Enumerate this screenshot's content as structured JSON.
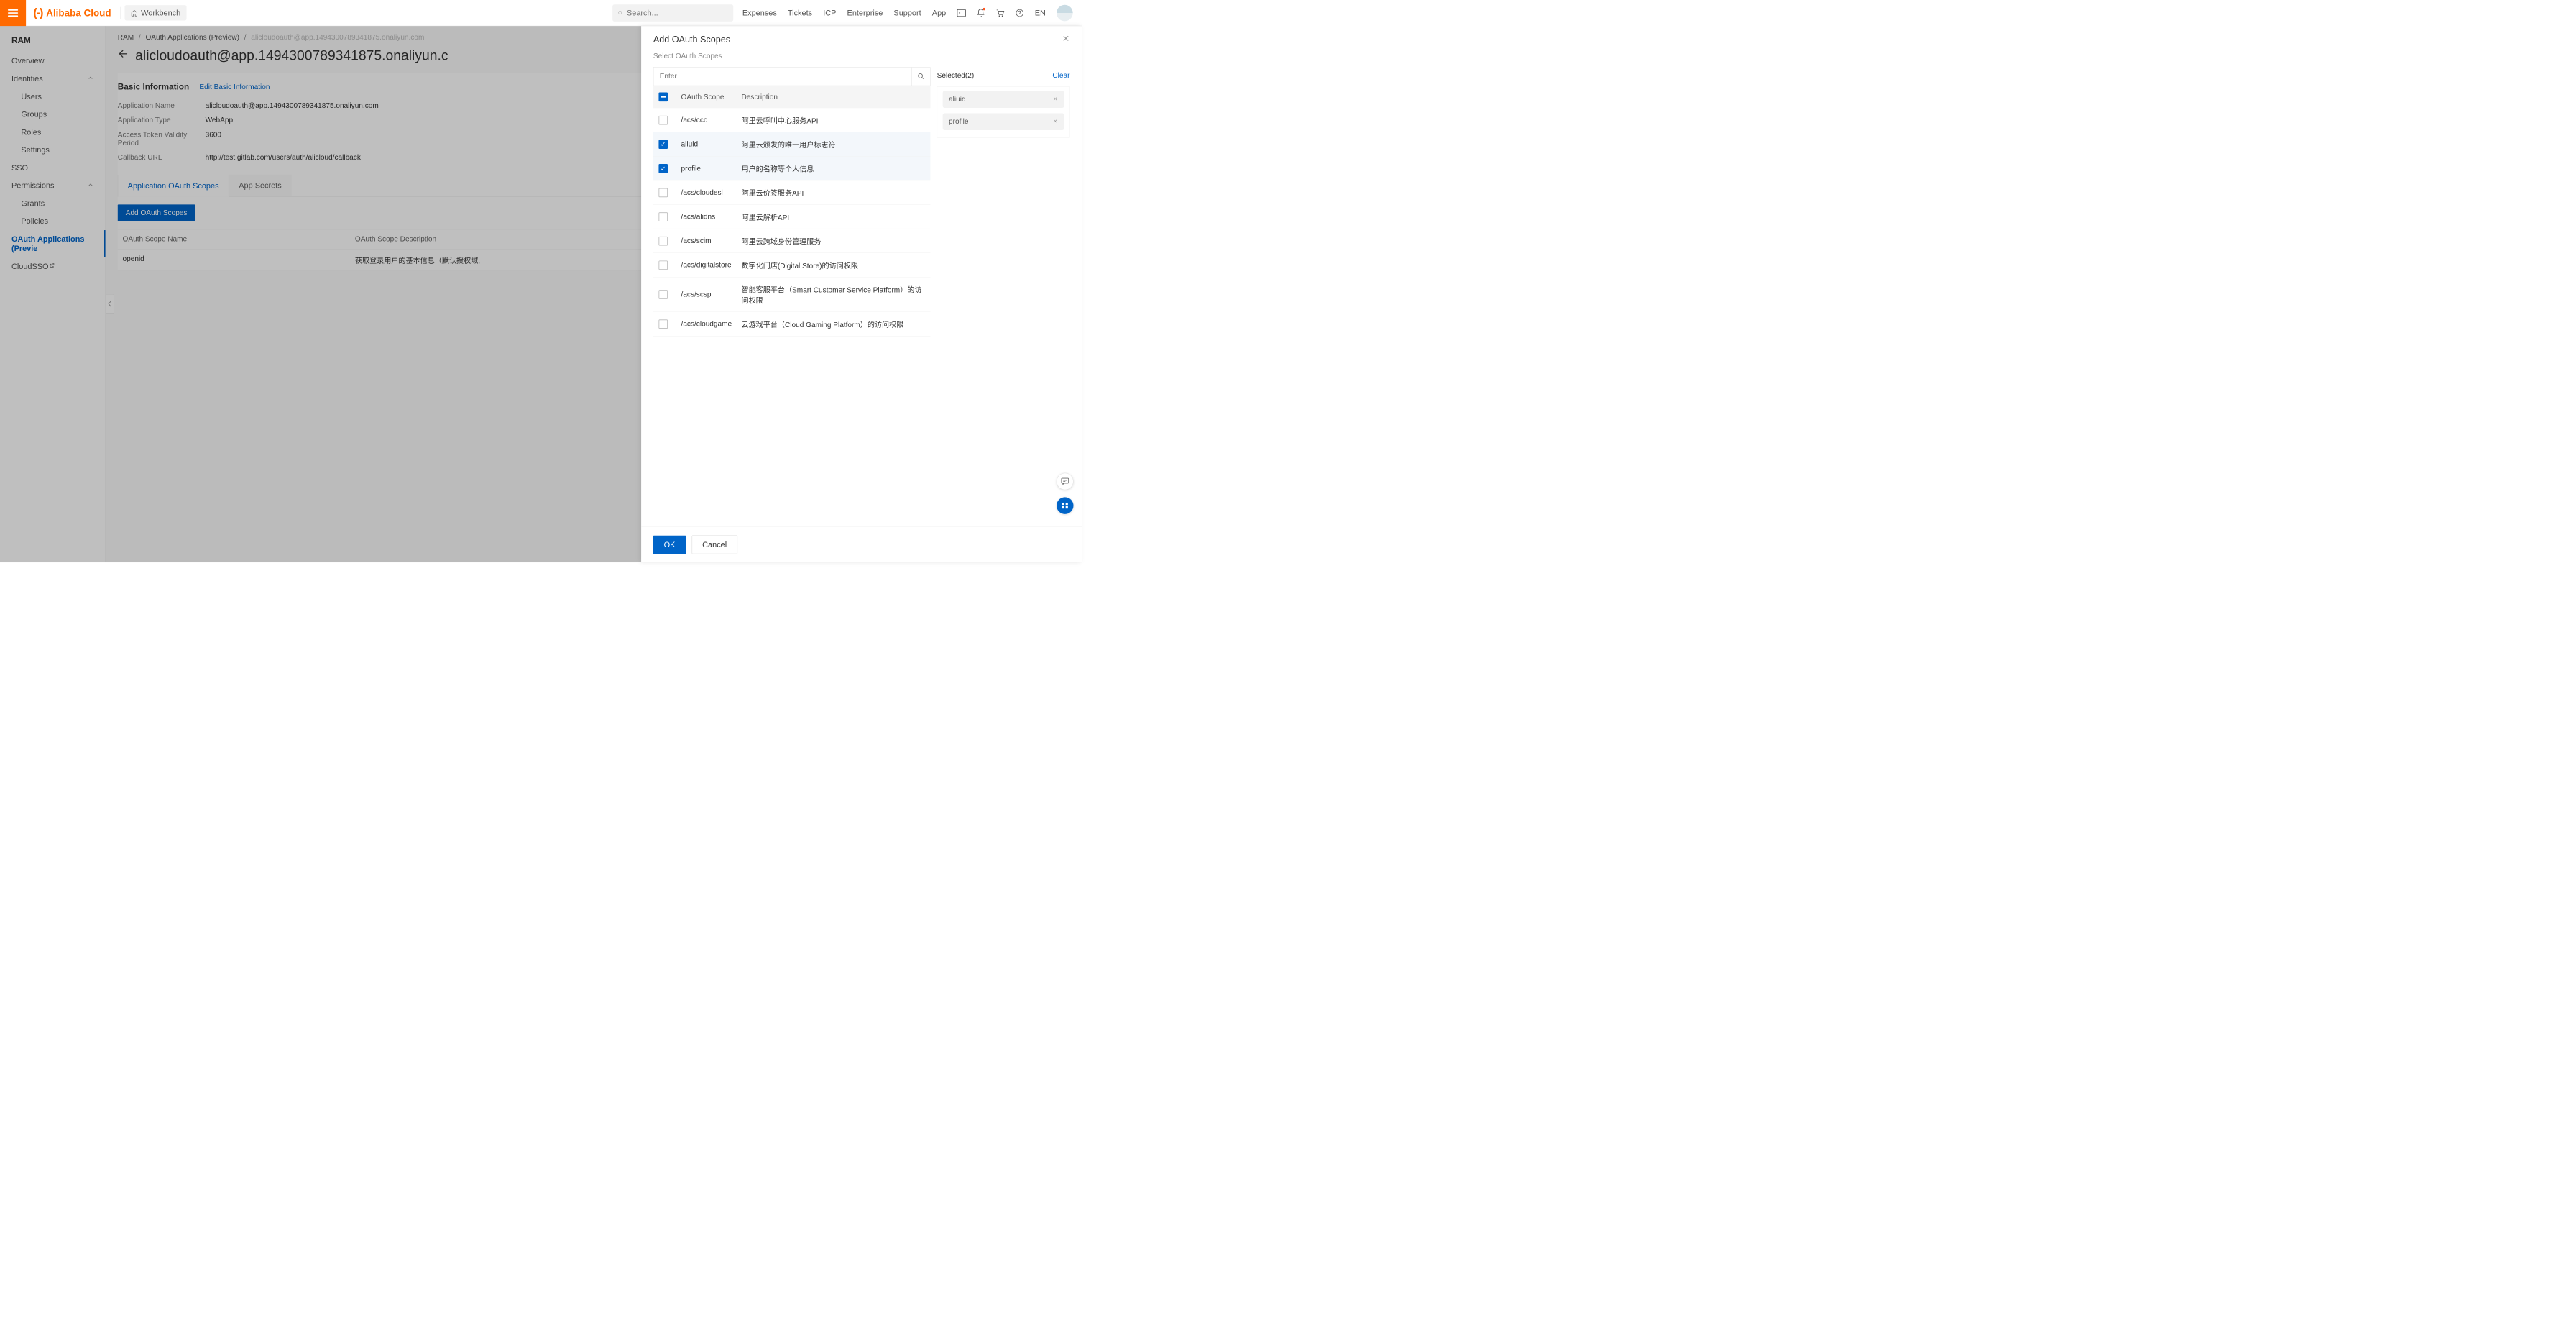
{
  "top": {
    "brand": "Alibaba Cloud",
    "workbench": "Workbench",
    "search_placeholder": "Search...",
    "nav": {
      "expenses": "Expenses",
      "tickets": "Tickets",
      "icp": "ICP",
      "enterprise": "Enterprise",
      "support": "Support",
      "app": "App",
      "lang": "EN"
    }
  },
  "sidebar": {
    "title": "RAM",
    "items": [
      {
        "label": "Overview"
      },
      {
        "label": "Identities",
        "expandable": true
      },
      {
        "label": "Users",
        "sub": true
      },
      {
        "label": "Groups",
        "sub": true
      },
      {
        "label": "Roles",
        "sub": true
      },
      {
        "label": "Settings",
        "sub": true
      },
      {
        "label": "SSO"
      },
      {
        "label": "Permissions",
        "expandable": true
      },
      {
        "label": "Grants",
        "sub": true
      },
      {
        "label": "Policies",
        "sub": true
      },
      {
        "label": "OAuth Applications (Previe",
        "active": true
      },
      {
        "label": "CloudSSO",
        "external": true
      }
    ]
  },
  "breadcrumb": {
    "a": "RAM",
    "b": "OAuth Applications (Preview)",
    "c": "alicloudoauth@app.1494300789341875.onaliyun.com",
    "sep": "/"
  },
  "page": {
    "title": "alicloudoauth@app.1494300789341875.onaliyun.c",
    "section_heading": "Basic Information",
    "edit_link": "Edit Basic Information",
    "info": [
      {
        "label": "Application Name",
        "value": "alicloudoauth@app.1494300789341875.onaliyun.com"
      },
      {
        "label": "Application Type",
        "value": "WebApp"
      },
      {
        "label": "Access Token Validity Period",
        "value": "3600"
      },
      {
        "label": "Callback URL",
        "value": "http://test.gitlab.com/users/auth/alicloud/callback"
      }
    ],
    "tabs": {
      "a": "Application OAuth Scopes",
      "b": "App Secrets"
    },
    "add_btn": "Add OAuth Scopes",
    "table": {
      "h1": "OAuth Scope Name",
      "h2": "OAuth Scope Description",
      "rows": [
        {
          "name": "openid",
          "desc": "获取登录用户的基本信息（默认授权域,"
        }
      ]
    }
  },
  "drawer": {
    "title": "Add OAuth Scopes",
    "hint": "Select OAuth Scopes",
    "search_placeholder": "Enter",
    "head_scope": "OAuth Scope",
    "head_desc": "Description",
    "rows": [
      {
        "scope": "/acs/ccc",
        "desc": "阿里云呼叫中心服务API",
        "checked": false
      },
      {
        "scope": "aliuid",
        "desc": "阿里云颁发的唯一用户标志符",
        "checked": true
      },
      {
        "scope": "profile",
        "desc": "用户的名称等个人信息",
        "checked": true
      },
      {
        "scope": "/acs/cloudesl",
        "desc": "阿里云价签服务API",
        "checked": false
      },
      {
        "scope": "/acs/alidns",
        "desc": "阿里云解析API",
        "checked": false
      },
      {
        "scope": "/acs/scim",
        "desc": "阿里云跨域身份管理服务",
        "checked": false
      },
      {
        "scope": "/acs/digitalstore",
        "desc": "数字化门店(Digital Store)的访问权限",
        "checked": false
      },
      {
        "scope": "/acs/scsp",
        "desc": "智能客服平台（Smart Customer Service Platform）的访问权限",
        "checked": false
      },
      {
        "scope": "/acs/cloudgame",
        "desc": "云游戏平台（Cloud Gaming Platform）的访问权限",
        "checked": false
      }
    ],
    "selected_label": "Selected(2)",
    "clear": "Clear",
    "chips": [
      "aliuid",
      "profile"
    ],
    "ok": "OK",
    "cancel": "Cancel"
  }
}
